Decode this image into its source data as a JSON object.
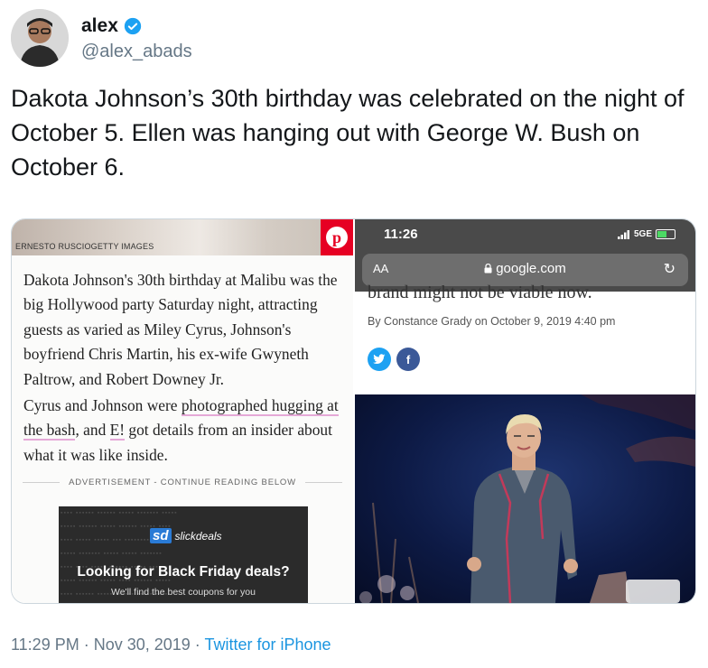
{
  "tweet": {
    "author_name": "alex",
    "author_handle": "@alex_abads",
    "text": "Dakota Johnson’s 30th birthday was celebrated on the night of October 5. Ellen was hanging out with George W. Bush on October 6.",
    "timestamp": "11:29 PM · Nov 30, 2019",
    "separator": " · ",
    "source": "Twitter for iPhone"
  },
  "left_image": {
    "photo_credit": "ERNESTO RUSCIOGETTY IMAGES",
    "paragraph1": "Dakota Johnson's 30th birthday at Malibu was the big Hollywood party Saturday night, attracting guests as varied as Miley Cyrus, Johnson's boyfriend Chris Martin, his ex-wife Gwyneth Paltrow, and Robert Downey Jr.",
    "p2_start": "Cyrus and Johnson were ",
    "p2_link1": "photographed hugging at the bash",
    "p2_mid": ", and ",
    "p2_link2": "E!",
    "p2_end": " got details from an insider about what it was like inside.",
    "ad_label": "ADVERTISEMENT - CONTINUE READING BELOW",
    "ad": {
      "logo_mark": "sd",
      "logo_text": "slickdeals",
      "headline": "Looking for Black Friday deals?",
      "subtext": "We'll find the best coupons for you"
    }
  },
  "right_image": {
    "time": "11:26",
    "network": "5GE",
    "aa": "AA",
    "url": "google.com",
    "cut_text": "brand might not be viable now.",
    "byline": "By Constance Grady on October 9, 2019 4:40 pm"
  },
  "icons": {
    "verified": "verified-badge-icon",
    "pinterest": "pinterest-icon",
    "lock": "lock-icon",
    "reload": "reload-icon",
    "twitter_share": "twitter-share-icon",
    "facebook_share": "facebook-share-icon"
  },
  "colors": {
    "link": "#1b95e0",
    "handle": "#657786",
    "verified": "#1da1f2",
    "pinterest": "#e60023"
  }
}
